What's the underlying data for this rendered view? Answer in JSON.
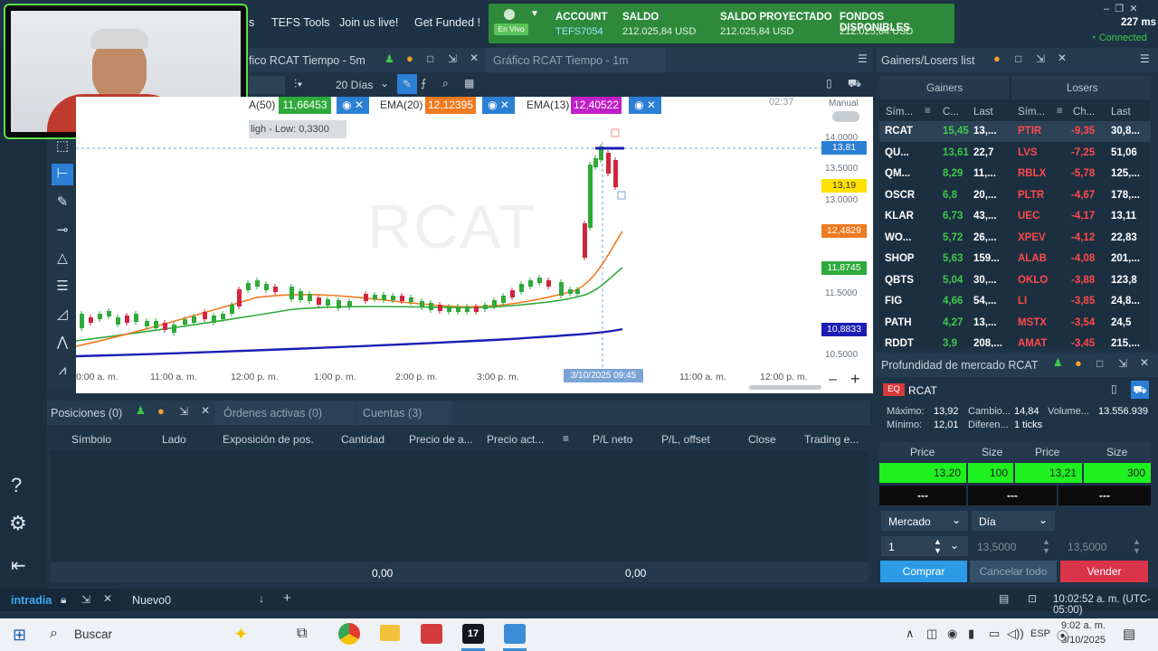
{
  "top_nav": {
    "partial": "s",
    "tools": "TEFS Tools",
    "live": "Join us live!",
    "funded": "Get Funded !"
  },
  "account": {
    "badge": "En Vivo",
    "account_label": "ACCOUNT",
    "account_value": "TEFS7054",
    "saldo_label": "SALDO",
    "saldo_value": "212.025,84 USD",
    "proj_label": "SALDO PROYECTADO",
    "proj_value": "212.025,84 USD",
    "fondos_label": "FONDOS DISPONIBLES",
    "fondos_value": "212.025,84 USD"
  },
  "status": {
    "latency": "227 ms",
    "connection": "Connected"
  },
  "chart": {
    "tab_active": "fico RCAT Tiempo - 5m",
    "tab_inactive": "Gráfico RCAT Tiempo - 1m",
    "period": "20 Días",
    "watermark": "RCAT",
    "manual": "Manual",
    "ema50_label": "A(50)",
    "ema50_value": "11,66453",
    "ema20_label": "EMA(20)",
    "ema20_value": "12,12395",
    "ema13_label": "EMA(13)",
    "ema13_value": "12,40522",
    "high_low": "ligh - Low: 0,3300",
    "price_ticks": [
      "14.0000",
      "13.5000",
      "13.0000",
      "11.5000",
      "10.5000"
    ],
    "price_badges": {
      "last": "13,81",
      "current": "13,19",
      "ema13": "12,4829",
      "ema20": "11,8745",
      "ema50": "10,8833"
    },
    "time_ticks": [
      "0:00 a. m.",
      "11:00 a. m.",
      "12:00 p. m.",
      "1:00 p. m.",
      "2:00 p. m.",
      "3:00 p. m.",
      "11:00 a. m.",
      "12:00 p. m."
    ],
    "crosshair_time": "3/10/2025 09:45",
    "countdown": "02:37"
  },
  "gainers_losers": {
    "title": "Gainers/Losers list",
    "gainers_title": "Gainers",
    "losers_title": "Losers",
    "cols": {
      "sym": "Sím...",
      "chg": "C...",
      "last": "Last",
      "sym2": "Sím...",
      "chg2": "Ch...",
      "last2": "Last"
    },
    "rows": [
      {
        "g": "RCAT",
        "gc": "15,45",
        "gl": "13,...",
        "l": "PTIR",
        "lc": "-9,35",
        "ll": "30,8..."
      },
      {
        "g": "QU...",
        "gc": "13,61",
        "gl": "22,7",
        "l": "LVS",
        "lc": "-7,25",
        "ll": "51,06"
      },
      {
        "g": "QM...",
        "gc": "8,29",
        "gl": "11,...",
        "l": "RBLX",
        "lc": "-5,78",
        "ll": "125,..."
      },
      {
        "g": "OSCR",
        "gc": "6,8",
        "gl": "20,...",
        "l": "PLTR",
        "lc": "-4,67",
        "ll": "178,..."
      },
      {
        "g": "KLAR",
        "gc": "6,73",
        "gl": "43,...",
        "l": "UEC",
        "lc": "-4,17",
        "ll": "13,11"
      },
      {
        "g": "WO...",
        "gc": "5,72",
        "gl": "26,...",
        "l": "XPEV",
        "lc": "-4,12",
        "ll": "22,83"
      },
      {
        "g": "SHOP",
        "gc": "5,63",
        "gl": "159...",
        "l": "ALAB",
        "lc": "-4,08",
        "ll": "201,..."
      },
      {
        "g": "QBTS",
        "gc": "5,04",
        "gl": "30,...",
        "l": "OKLO",
        "lc": "-3,88",
        "ll": "123,8"
      },
      {
        "g": "FIG",
        "gc": "4,66",
        "gl": "54,...",
        "l": "LI",
        "lc": "-3,85",
        "ll": "24,8..."
      },
      {
        "g": "PATH",
        "gc": "4,27",
        "gl": "13,...",
        "l": "MSTX",
        "lc": "-3,54",
        "ll": "24,5"
      },
      {
        "g": "RDDT",
        "gc": "3,9",
        "gl": "208,...",
        "l": "AMAT",
        "lc": "-3,45",
        "ll": "215,..."
      }
    ]
  },
  "depth": {
    "title": "Profundidad de mercado RCAT",
    "eq": "EQ",
    "symbol": "RCAT",
    "max_label": "Máximo:",
    "max_value": "13,92",
    "min_label": "Mínimo:",
    "min_value": "12,01",
    "change_label": "Cambio...",
    "change_value": "14,84",
    "diff_label": "Diferen...",
    "diff_value": "1 ticks",
    "vol_label": "Volume...",
    "vol_value": "13.556.939",
    "price_h": "Price",
    "size_h": "Size",
    "bid_price": "13,20",
    "bid_size": "100",
    "ask_price": "13,21",
    "ask_size": "300",
    "dash": "---",
    "order_type": "Mercado",
    "tif": "Día",
    "qty": "1",
    "limit_price": "13,5000",
    "stop_price": "13,5000",
    "buy": "Comprar",
    "cancel_all": "Cancelar todo",
    "sell": "Vender"
  },
  "positions": {
    "tab_positions": "Posiciones (0)",
    "tab_orders": "Órdenes activas (0)",
    "tab_accounts": "Cuentas (3)",
    "cols": [
      "Símbolo",
      "Lado",
      "Exposición de pos.",
      "Cantidad",
      "Precio de a...",
      "Precio act...",
      "P/L neto",
      "P/L, offset",
      "Close",
      "Trading e..."
    ],
    "total_pl": "0,00",
    "total_offset": "0,00"
  },
  "workspace": {
    "tab1": "intradia",
    "tab2": "Nuevo0",
    "time": "10:02:52 a. m. (UTC-05:00)"
  },
  "taskbar": {
    "search": "Buscar",
    "lang": "ESP",
    "time": "9:02 a. m.",
    "date": "3/10/2025"
  }
}
